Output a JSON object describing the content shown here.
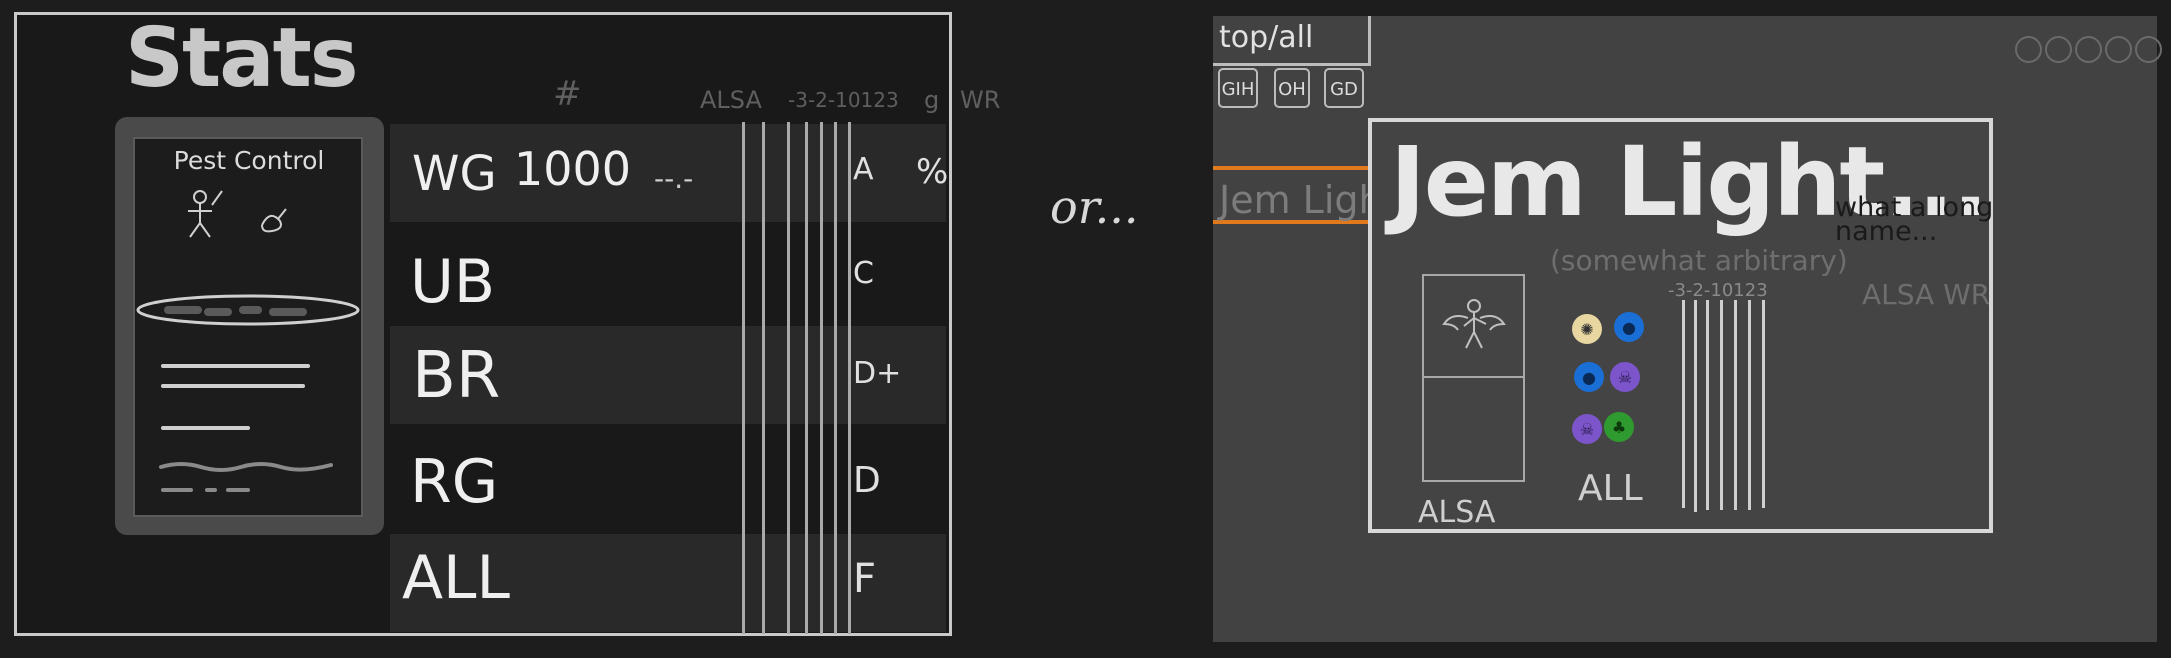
{
  "left_mockup": {
    "title": "Stats",
    "card_name": "Pest Control",
    "headers": {
      "count": "#",
      "alsa": "ALSA",
      "scale": "-3-2-10123",
      "grade": "g",
      "wr": "WR"
    },
    "rows": [
      {
        "deck": "WG",
        "count": "1000",
        "alsa": "--.-",
        "grade": "A",
        "wr": "%"
      },
      {
        "deck": "UB",
        "count": "",
        "alsa": "",
        "grade": "C",
        "wr": ""
      },
      {
        "deck": "BR",
        "count": "",
        "alsa": "",
        "grade": "D+",
        "wr": ""
      },
      {
        "deck": "RG",
        "count": "",
        "alsa": "",
        "grade": "D",
        "wr": ""
      },
      {
        "deck": "ALL",
        "count": "",
        "alsa": "",
        "grade": "F",
        "wr": ""
      }
    ]
  },
  "separator": "or...",
  "right_mockup": {
    "top_tab": "top/all",
    "tabs": [
      "GIH",
      "OH",
      "GD"
    ],
    "selected_card_tab": "Jem Light",
    "card_title": "Jem Light...",
    "long_name_note": "what a long name...",
    "subtitle": "(somewhat arbitrary)",
    "scale": "-3-2-10123",
    "header_alsa_wr": "ALSA WR",
    "alsa_label": "ALSA",
    "all_label": "ALL",
    "mana_icons": [
      "sun-icon",
      "water-drop-icon",
      "water-drop-icon",
      "skull-icon",
      "skull-icon",
      "tree-icon"
    ],
    "colors": {
      "accent_orange": "#e07a1c",
      "white_mana": "#e8d7a0",
      "blue_mana": "#1a6fd6",
      "black_mana": "#7b55c9",
      "green_mana": "#2f9a2f"
    }
  }
}
